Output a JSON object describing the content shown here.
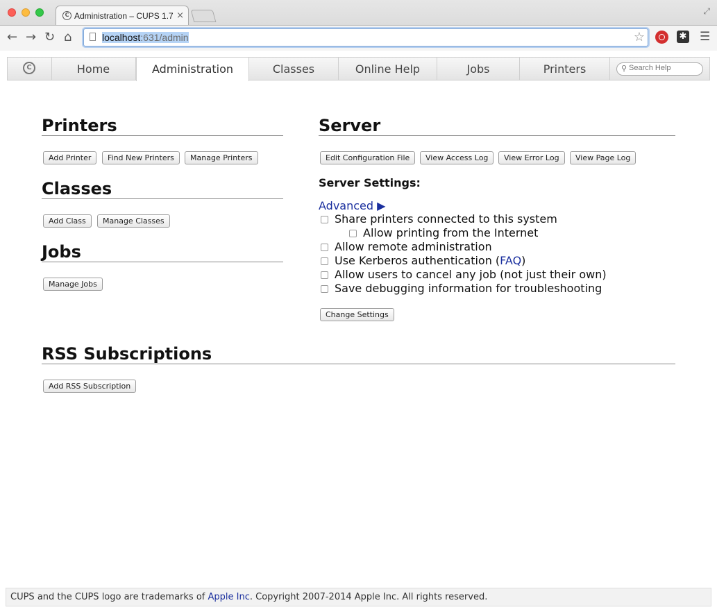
{
  "browser": {
    "tab_title": "Administration – CUPS 1.7",
    "tab_close": "×",
    "url_host": "localhost",
    "url_rest": ":631/admin",
    "back": "←",
    "forward": "→",
    "reload": "↻",
    "home": "⌂"
  },
  "nav": {
    "tabs": [
      "Home",
      "Administration",
      "Classes",
      "Online Help",
      "Jobs",
      "Printers"
    ],
    "active_tab": "Administration",
    "search_placeholder": "Search Help"
  },
  "printers": {
    "title": "Printers",
    "add": "Add Printer",
    "find": "Find New Printers",
    "manage": "Manage Printers"
  },
  "classes": {
    "title": "Classes",
    "add": "Add Class",
    "manage": "Manage Classes"
  },
  "jobs": {
    "title": "Jobs",
    "manage": "Manage Jobs"
  },
  "server": {
    "title": "Server",
    "edit_config": "Edit Configuration File",
    "access_log": "View Access Log",
    "error_log": "View Error Log",
    "page_log": "View Page Log",
    "settings_heading": "Server Settings:",
    "advanced": "Advanced",
    "share": "Share printers connected to this system",
    "internet": "Allow printing from the Internet",
    "remote_admin": "Allow remote administration",
    "kerberos_pre": "Use Kerberos authentication (",
    "kerberos_link": "FAQ",
    "kerberos_post": ")",
    "cancel_any": "Allow users to cancel any job (not just their own)",
    "debug": "Save debugging information for troubleshooting",
    "change": "Change Settings",
    "checkboxes": {
      "share": false,
      "internet": false,
      "remote_admin": false,
      "kerberos": false,
      "cancel_any": false,
      "debug": false
    }
  },
  "rss": {
    "title": "RSS Subscriptions",
    "add": "Add RSS Subscription"
  },
  "footer": {
    "pre": "CUPS and the CUPS logo are trademarks of ",
    "link": "Apple Inc",
    "post": ". Copyright 2007-2014 Apple Inc. All rights reserved."
  }
}
